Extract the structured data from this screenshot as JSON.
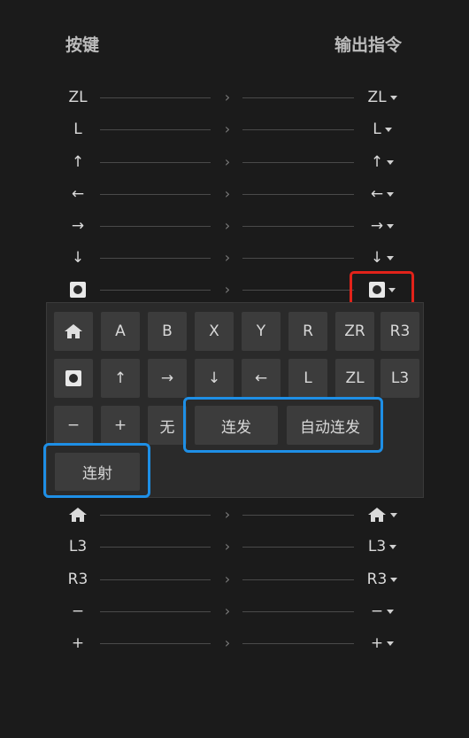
{
  "header": {
    "left": "按键",
    "right": "输出指令"
  },
  "rows_top": [
    {
      "key": "ZL",
      "out": "ZL"
    },
    {
      "key": "L",
      "out": "L"
    },
    {
      "key": "↑",
      "out": "↑"
    },
    {
      "key": "←",
      "out": "←"
    },
    {
      "key": "→",
      "out": "→"
    },
    {
      "key": "↓",
      "out": "↓"
    }
  ],
  "rows_bottom": [
    {
      "key": "",
      "out": "",
      "icon": "home-icon"
    },
    {
      "key": "L3",
      "out": "L3"
    },
    {
      "key": "R3",
      "out": "R3"
    },
    {
      "key": "−",
      "out": "−"
    },
    {
      "key": "+",
      "out": "+"
    }
  ],
  "chevron": "›",
  "panel": {
    "row1": [
      "A",
      "B",
      "X",
      "Y",
      "R",
      "ZR",
      "R3"
    ],
    "row2": [
      "↑",
      "→",
      "↓",
      "←",
      "L",
      "ZL",
      "L3"
    ],
    "row3": [
      "−",
      "+",
      "无"
    ],
    "rapid_fire": "连发",
    "auto_rapid_fire": "自动连发",
    "burst": "连射"
  }
}
